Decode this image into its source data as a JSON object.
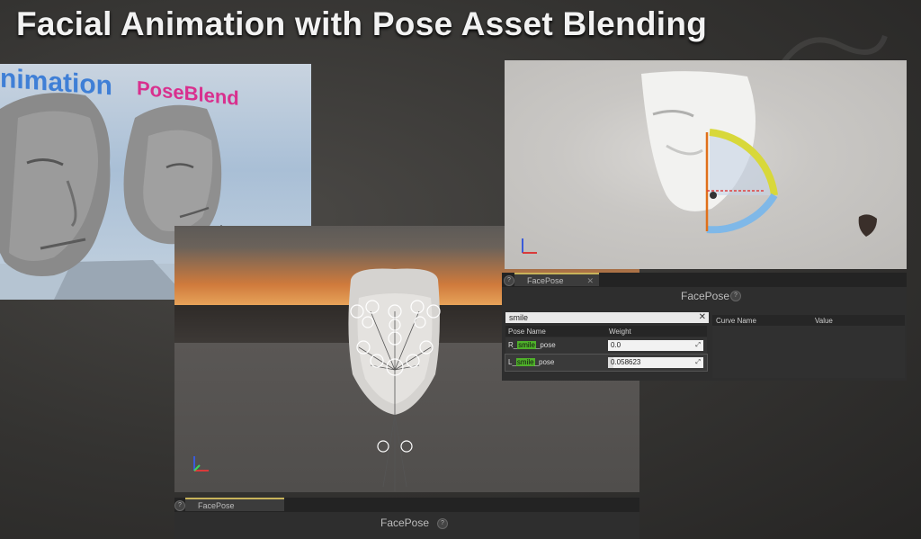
{
  "slide": {
    "title": "Facial Animation with Pose Asset Blending"
  },
  "viewport_left": {
    "text_animation": "nimation",
    "text_poseblend": "PoseBlend"
  },
  "viewport_center": {
    "panel_tab": "FacePose",
    "panel_title": "FacePose"
  },
  "viewport_right": {
    "panel_tab": "FacePose",
    "panel_title": "FacePose",
    "search_value": "smile",
    "headers": {
      "pose_name": "Pose Name",
      "weight": "Weight",
      "curve_name": "Curve Name",
      "value": "Value"
    },
    "poses": [
      {
        "prefix": "R_",
        "match": "smile",
        "suffix": "_pose",
        "weight_text": "0.0",
        "weight": 0.0
      },
      {
        "prefix": "L_",
        "match": "smile",
        "suffix": "_pose",
        "weight_text": "0.058623",
        "weight": 0.058623
      }
    ]
  },
  "colors": {
    "accent_tab": "#c8b35a",
    "search_highlight": "#4fb12a",
    "text_animation": "#3f7fd6",
    "text_poseblend": "#d8308e"
  },
  "icons": [
    "help-icon",
    "close-icon",
    "clear-search-icon",
    "expand-arrows-icon",
    "axis-gizmo-icon",
    "bone-control-icon"
  ]
}
